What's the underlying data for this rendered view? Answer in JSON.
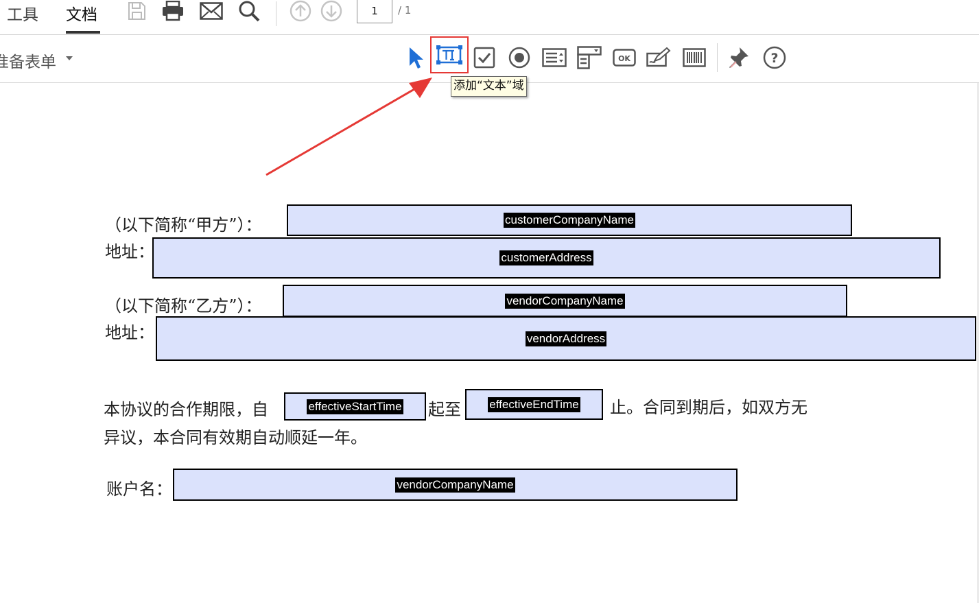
{
  "toolbar": {
    "tabs": [
      {
        "label": "工具",
        "active": false
      },
      {
        "label": "文档",
        "active": true
      }
    ],
    "icons": [
      "save-icon",
      "print-icon",
      "email-icon",
      "search-icon",
      "page-up-icon",
      "page-down-icon"
    ],
    "page_current": "1",
    "page_total": "/ 1"
  },
  "form_toolbar": {
    "title": "准备表单",
    "tools": [
      "select-cursor-icon",
      "text-field-icon",
      "checkbox-icon",
      "radio-button-icon",
      "list-box-icon",
      "dropdown-icon",
      "button-icon",
      "signature-icon",
      "barcode-icon",
      "pin-icon",
      "help-icon"
    ],
    "selected_tool": "text-field-icon",
    "tooltip": "添加“文本”域",
    "accent_red": "#e53935",
    "cursor_blue": "#1f6fd6"
  },
  "document": {
    "party_a_label": "（以下简称“甲方”）：",
    "party_a_address_label": "地址：",
    "party_b_label": "（以下简称“乙方”）：",
    "party_b_address_label": "地址：",
    "term_text_1": "本协议的合作期限，自",
    "term_text_2": "起至",
    "term_text_3": "止。合同到期后，如双方无",
    "term_text_4": "异议，本合同有效期自动顺延一年。",
    "account_label": "账户名：",
    "fields": {
      "customer_company_name": "customerCompanyName",
      "customer_address": "customerAddress",
      "vendor_company_name": "vendorCompanyName",
      "vendor_address": "vendorAddress",
      "effective_start_time": "effectiveStartTime",
      "effective_end_time": "effectiveEndTime",
      "account_name": "vendorCompanyName"
    },
    "field_fill": "#dbe2fc"
  }
}
